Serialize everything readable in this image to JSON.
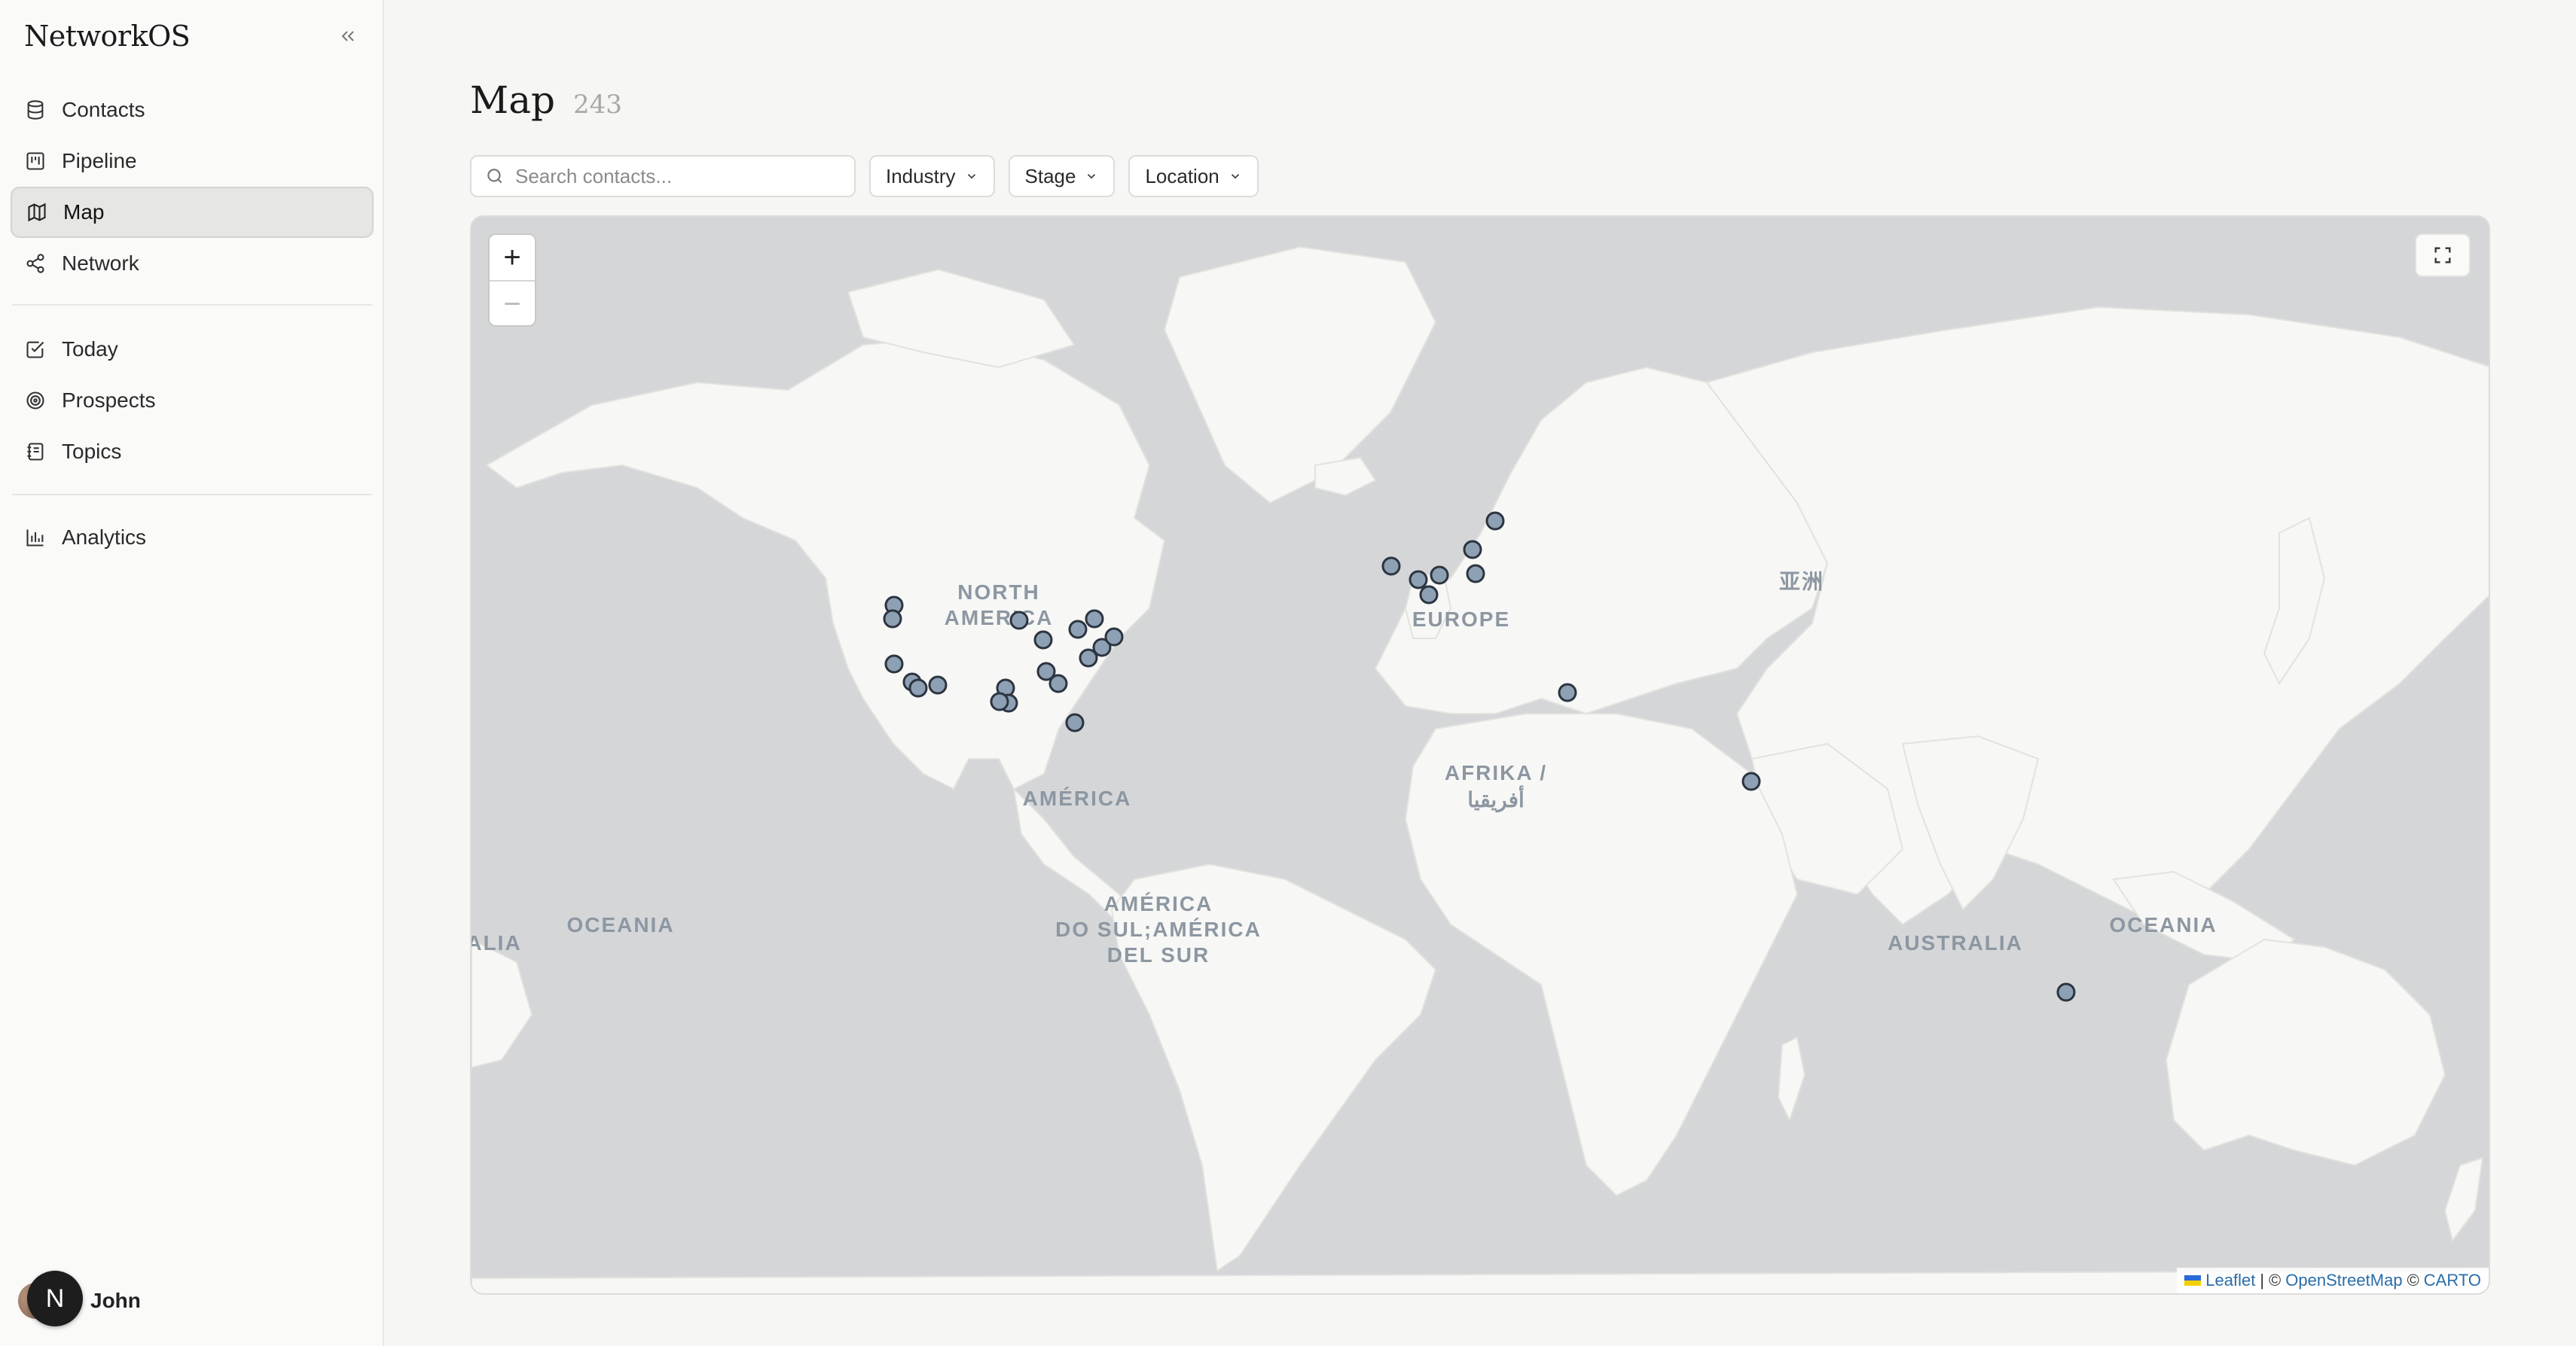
{
  "app": {
    "brand": "NetworkOS"
  },
  "sidebar": {
    "primary": [
      {
        "label": "Contacts",
        "icon": "database-icon"
      },
      {
        "label": "Pipeline",
        "icon": "kanban-icon"
      },
      {
        "label": "Map",
        "icon": "map-icon",
        "active": true
      },
      {
        "label": "Network",
        "icon": "share-icon"
      }
    ],
    "secondary": [
      {
        "label": "Today",
        "icon": "checkbox-icon"
      },
      {
        "label": "Prospects",
        "icon": "target-icon"
      },
      {
        "label": "Topics",
        "icon": "notebook-icon"
      }
    ],
    "tertiary": [
      {
        "label": "Analytics",
        "icon": "bar-chart-icon"
      }
    ],
    "user": {
      "name": "John",
      "badge": "N"
    }
  },
  "main": {
    "title": "Map",
    "count": "243",
    "search_placeholder": "Search contacts...",
    "filters": [
      "Industry",
      "Stage",
      "Location"
    ]
  },
  "map": {
    "zoom_in": "+",
    "zoom_out": "−",
    "labels": {
      "north_america": [
        "NORTH",
        "AMERICA"
      ],
      "europe": "EUROPE",
      "asia": "亚洲",
      "africa": [
        "AFRIKA /",
        "أفريقيا"
      ],
      "america": "AMÉRICA",
      "south_america": [
        "AMÉRICA",
        "DO SUL;AMÉRICA",
        "DEL SUR"
      ],
      "oceania_left": "OCEANIA",
      "oceania_right": "OCEANIA",
      "australia": "AUSTRALIA",
      "alia": "ALIA"
    },
    "attribution": {
      "leaflet": "Leaflet",
      "sep1": "|",
      "copy1": "©",
      "osm": "OpenStreetMap",
      "copy2": "©",
      "carto": "CARTO"
    },
    "colors": {
      "ocean": "#d4d6d8",
      "land": "#f7f7f5",
      "marker": "#8ea0b4",
      "marker_stroke": "#2c3440"
    }
  }
}
